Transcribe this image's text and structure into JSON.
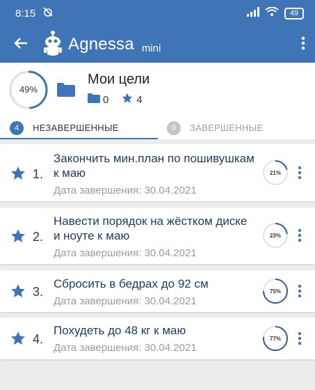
{
  "status_bar": {
    "time": "8:15",
    "battery": "49"
  },
  "app_bar": {
    "title": "Agnessa",
    "subtitle": "mini"
  },
  "header": {
    "percent_label": "49%",
    "percent": 0.49,
    "title": "Мои цели",
    "folders_count": "0",
    "stars_count": "4"
  },
  "tabs": [
    {
      "count": "4",
      "label": "НЕЗАВЕРШЕННЫЕ",
      "active": true
    },
    {
      "count": "0",
      "label": "ЗАВЕРШЕННЫЕ",
      "active": false
    }
  ],
  "goals": [
    {
      "number": "1.",
      "title": "Закончить мин.план по пошивушкам к маю",
      "due": "Дата завершения: 30.04.2021",
      "progress_label": "21%",
      "progress": 0.21
    },
    {
      "number": "2.",
      "title": "Навести порядок на жёстком диске и ноуте к маю",
      "due": "Дата завершения: 30.04.2021",
      "progress_label": "23%",
      "progress": 0.23
    },
    {
      "number": "3.",
      "title": "Сбросить в бедрах до 92 см",
      "due": "Дата завершения: 30.04.2021",
      "progress_label": "75%",
      "progress": 0.75
    },
    {
      "number": "4.",
      "title": "Похудеть до 48 кг к маю",
      "due": "Дата завершения: 30.04.2021",
      "progress_label": "77%",
      "progress": 0.77
    }
  ],
  "colors": {
    "primary": "#3f74b6",
    "text_dark": "#1e3a5f",
    "muted": "#9b9b9b",
    "ring_track": "#e0e0e0"
  }
}
